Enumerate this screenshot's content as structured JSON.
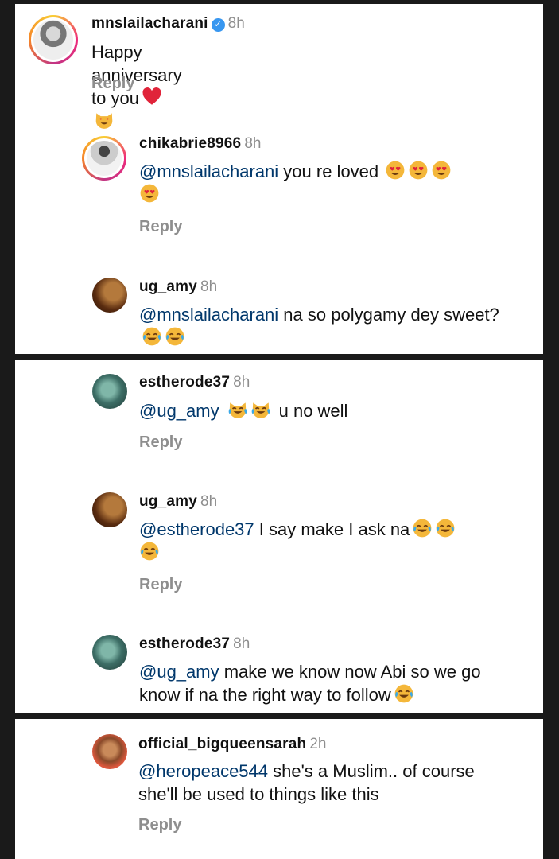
{
  "comments": [
    {
      "username": "mnslailacharani",
      "time": "8h",
      "text": "Happy anniversary to you",
      "reply": "Reply"
    },
    {
      "username": "chikabrie8966",
      "time": "8h",
      "mention": "@mnslailacharani",
      "text": " you re loved",
      "reply": "Reply"
    },
    {
      "username": "ug_amy",
      "time": "8h",
      "mention": "@mnslailacharani",
      "text": " na so polygamy dey sweet?"
    },
    {
      "username": "estherode37",
      "time": "8h",
      "mention": "@ug_amy",
      "text": "u no well",
      "reply": "Reply"
    },
    {
      "username": "ug_amy",
      "time": "8h",
      "mention": "@estherode37",
      "text": " I say make I ask na",
      "reply": "Reply"
    },
    {
      "username": "estherode37",
      "time": "8h",
      "mention": "@ug_amy",
      "text": " make we know now Abi so we go know if na the right way to follow"
    },
    {
      "username": "official_bigqueensarah",
      "time": "2h",
      "mention": "@heropeace544",
      "text": " she's a Muslim.. of course she'll be used to things like this",
      "reply": "Reply"
    }
  ],
  "icons": {
    "verified": "verified-badge-icon",
    "heart": "red-heart-emoji",
    "heart_eyes_cat": "heart-eyes-cat-emoji",
    "heart_eyes": "heart-eyes-emoji",
    "tears_of_joy": "tears-of-joy-emoji",
    "joy_cat": "joy-cat-emoji"
  },
  "colors": {
    "mention": "#00376b",
    "meta": "#8e8e8e",
    "verified": "#3897f0",
    "separator": "#1a1a1a"
  }
}
